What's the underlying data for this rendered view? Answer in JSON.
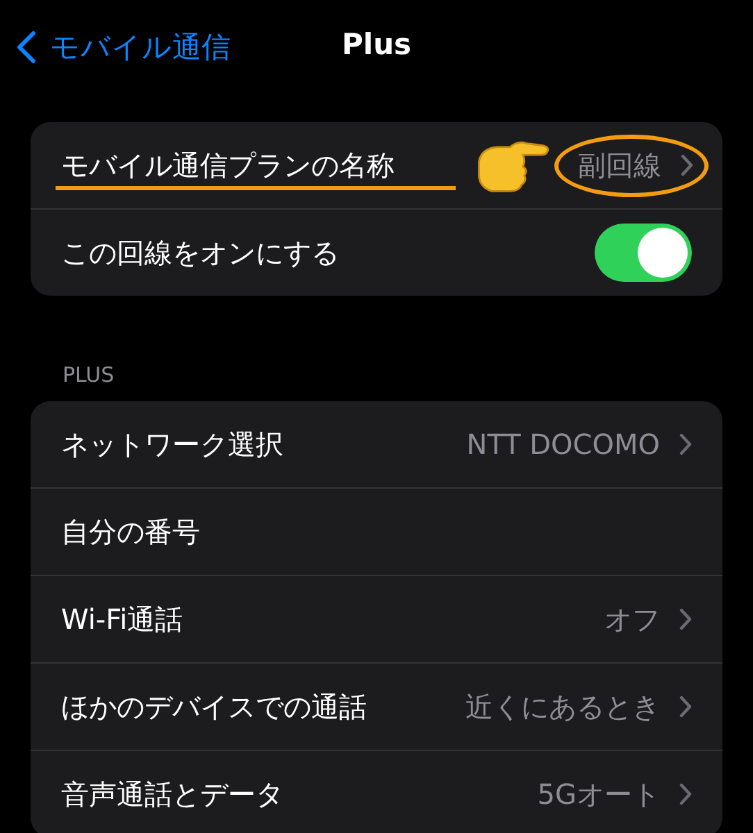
{
  "nav": {
    "back": "モバイル通信",
    "title": "Plus"
  },
  "groups": [
    {
      "rows": [
        {
          "kind": "link",
          "label": "モバイル通信プランの名称",
          "value": "副回線",
          "highlighted": true
        },
        {
          "kind": "toggle",
          "label": "この回線をオンにする",
          "on": true
        }
      ]
    },
    {
      "header": "PLUS",
      "rows": [
        {
          "kind": "link",
          "label": "ネットワーク選択",
          "value": "NTT DOCOMO",
          "highlighted": false
        },
        {
          "kind": "plain",
          "label": "自分の番号"
        },
        {
          "kind": "link",
          "label": "Wi-Fi通話",
          "value": "オフ",
          "highlighted": false
        },
        {
          "kind": "link",
          "label": "ほかのデバイスでの通話",
          "value": "近くにあるとき",
          "highlighted": false
        },
        {
          "kind": "link",
          "label": "音声通話とデータ",
          "value": "5Gオート",
          "highlighted": false
        }
      ]
    }
  ]
}
